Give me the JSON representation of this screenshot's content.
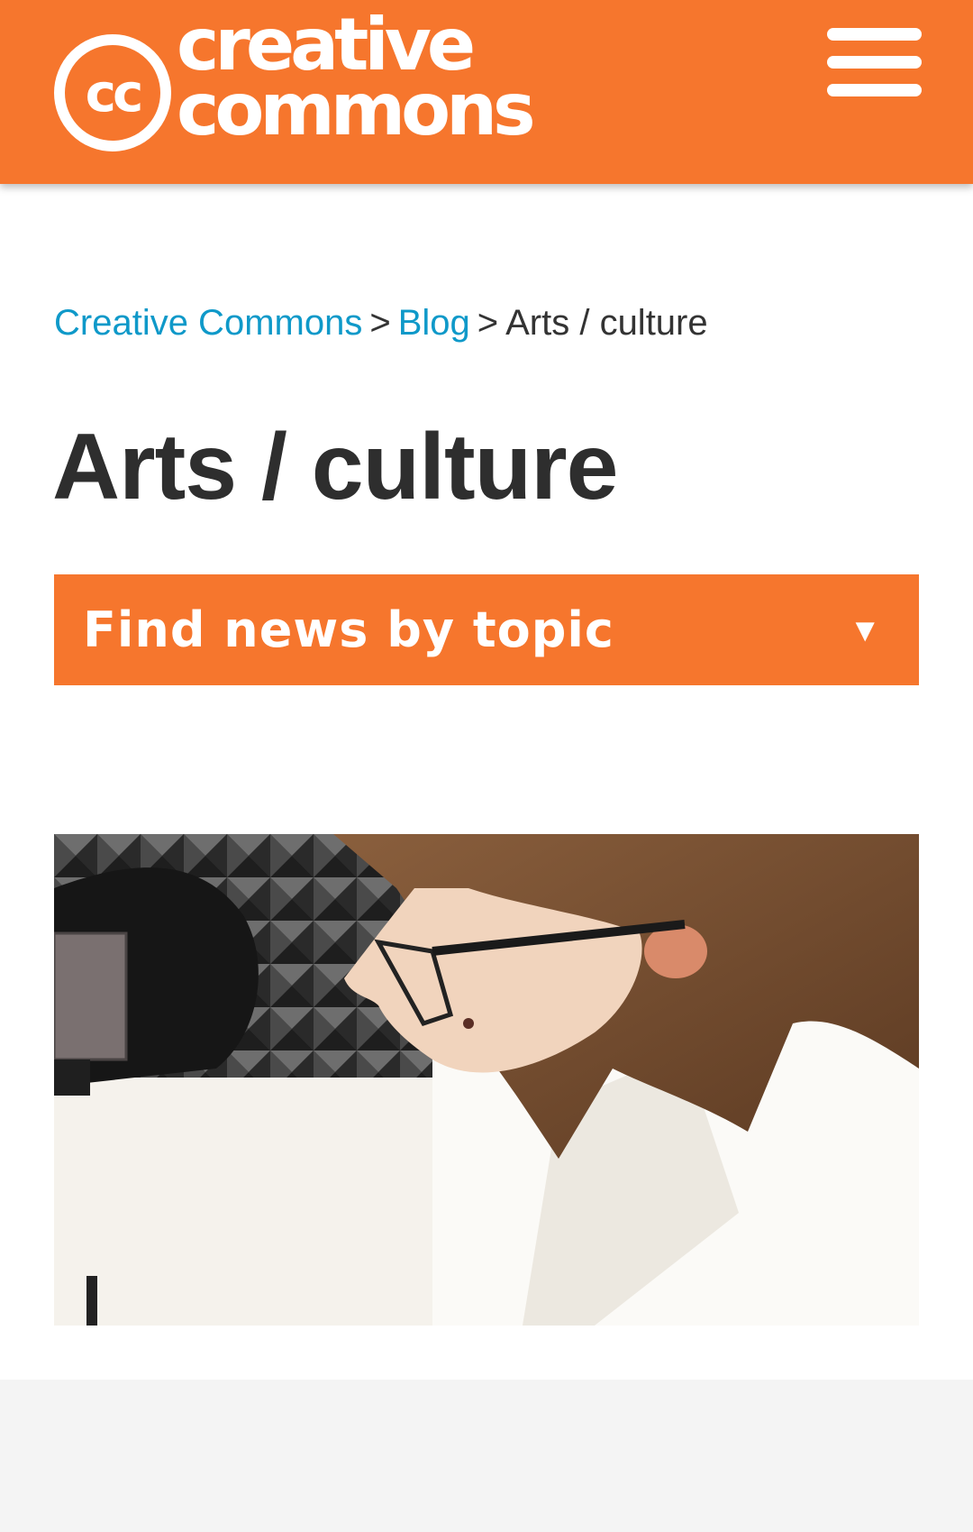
{
  "header": {
    "logo_badge": "cc",
    "logo_line1": "creative",
    "logo_line2": "commons",
    "menu_icon": "hamburger-menu-icon",
    "brand_color": "#f6762d"
  },
  "breadcrumb": {
    "items": [
      {
        "label": "Creative Commons",
        "link": true
      },
      {
        "label": "Blog",
        "link": true
      },
      {
        "label": "Arts / culture",
        "link": false
      }
    ],
    "separator": ">",
    "link_color": "#0f99c9"
  },
  "page": {
    "title": "Arts / culture"
  },
  "topic_filter": {
    "label": "Find news by topic",
    "arrow_icon": "triangle-down-icon"
  },
  "feature_image": {
    "icon": "photo-woman-at-microphone"
  }
}
